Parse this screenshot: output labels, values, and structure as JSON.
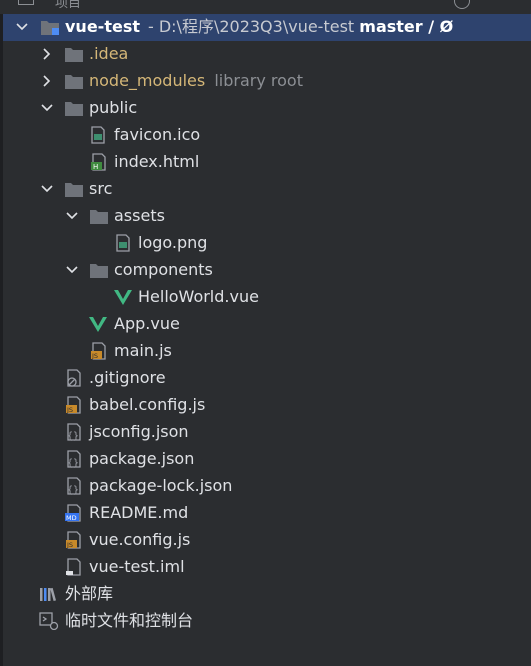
{
  "header_fragment": "项目",
  "tree": {
    "root": {
      "name": "vue-test",
      "path": "- D:\\程序\\2023Q3\\vue-test",
      "branch": "master / Ø"
    },
    "idea": ".idea",
    "node_modules": {
      "name": "node_modules",
      "hint": "library root"
    },
    "public": {
      "name": "public",
      "favicon": "favicon.ico",
      "index": "index.html"
    },
    "src": {
      "name": "src",
      "assets": {
        "name": "assets",
        "logo": "logo.png"
      },
      "components": {
        "name": "components",
        "helloworld": "HelloWorld.vue"
      },
      "app": "App.vue",
      "main": "main.js"
    },
    "files": {
      "gitignore": ".gitignore",
      "babel": "babel.config.js",
      "jsconfig": "jsconfig.json",
      "package": "package.json",
      "package_lock": "package-lock.json",
      "readme": "README.md",
      "vue_config": "vue.config.js",
      "iml": "vue-test.iml"
    },
    "external_libraries": "外部库",
    "scratches": "临时文件和控制台"
  },
  "colors": {
    "background": "#2b2d30",
    "selection": "#2e436e",
    "excluded_text": "#d5b778",
    "vue_green": "#41b883",
    "folder": "#6f737a"
  }
}
